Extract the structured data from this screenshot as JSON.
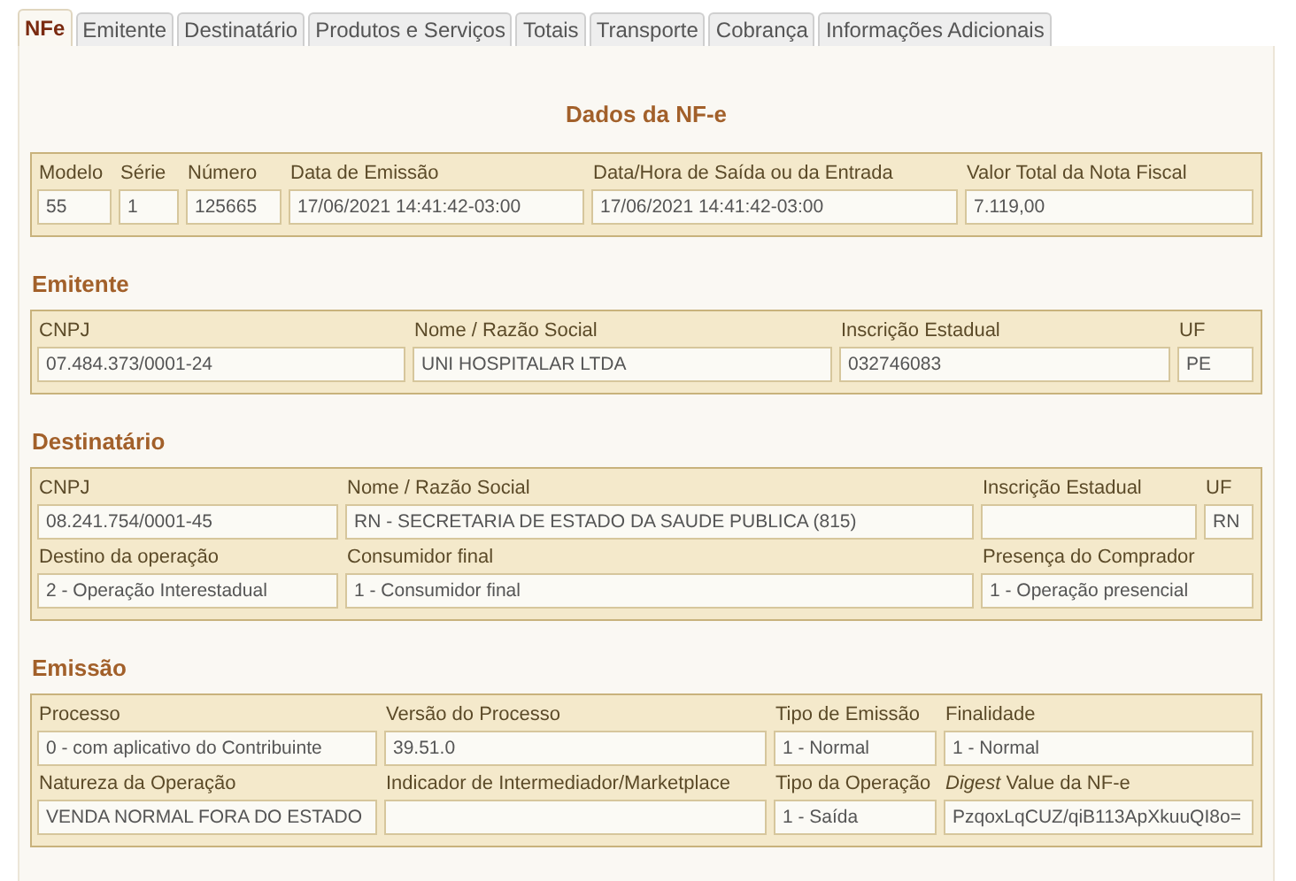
{
  "tabs": [
    {
      "label": "NFe",
      "selected": true
    },
    {
      "label": "Emitente",
      "selected": false
    },
    {
      "label": "Destinatário",
      "selected": false
    },
    {
      "label": "Produtos e Serviços",
      "selected": false
    },
    {
      "label": "Totais",
      "selected": false
    },
    {
      "label": "Transporte",
      "selected": false
    },
    {
      "label": "Cobrança",
      "selected": false
    },
    {
      "label": "Informações Adicionais",
      "selected": false
    }
  ],
  "sections": [
    {
      "title": "Dados da NF-e",
      "kind": "centered",
      "rows": [
        [
          {
            "label": "Modelo",
            "value": "55"
          },
          {
            "label": "Série",
            "value": "1"
          },
          {
            "label": "Número",
            "value": "125665"
          },
          {
            "label": "Data de Emissão",
            "value": "17/06/2021 14:41:42-03:00"
          },
          {
            "label": "Data/Hora de Saída ou da Entrada",
            "value": "17/06/2021 14:41:42-03:00"
          },
          {
            "label": "Valor Total da Nota Fiscal",
            "value": "7.119,00"
          }
        ]
      ]
    },
    {
      "title": "Emitente",
      "kind": "plain",
      "rows": [
        [
          {
            "label": "CNPJ",
            "value": "07.484.373/0001-24"
          },
          {
            "label": "Nome / Razão Social",
            "value": "UNI HOSPITALAR LTDA"
          },
          {
            "label": "Inscrição Estadual",
            "value": "032746083"
          },
          {
            "label": "UF",
            "value": "PE"
          }
        ]
      ]
    },
    {
      "title": "Destinatário",
      "kind": "plain",
      "rows": [
        [
          {
            "label": "CNPJ",
            "value": "08.241.754/0001-45"
          },
          {
            "label": "Nome / Razão Social",
            "value": "RN - SECRETARIA DE ESTADO DA SAUDE PUBLICA (815)"
          },
          {
            "label": "Inscrição Estadual"
          },
          {
            "label": "UF",
            "value": "RN"
          }
        ],
        [
          {
            "label": "Destino da operação",
            "value": "2 - Operação Interestadual"
          },
          {
            "label": "Consumidor final",
            "value": "1 - Consumidor final"
          },
          {
            "label": "Presença do Comprador",
            "value": "1 - Operação presencial"
          }
        ]
      ]
    },
    {
      "title": "Emissão",
      "kind": "plain",
      "rows": [
        [
          {
            "label": "Processo",
            "value": "0 - com aplicativo do Contribuinte"
          },
          {
            "label": "Versão do Processo",
            "value": "39.51.0"
          },
          {
            "label": "Tipo de Emissão",
            "value": "1 - Normal"
          },
          {
            "label": "Finalidade",
            "value": "1 - Normal"
          }
        ],
        [
          {
            "label": "Natureza da Operação",
            "value": "VENDA NORMAL FORA DO ESTADO"
          },
          {
            "label": "Indicador de Intermediador/Marketplace"
          },
          {
            "label": "Tipo da Operação",
            "value": "1 - Saída"
          },
          {
            "label": "*Digest* Value da NF-e",
            "value": "PzqoxLqCUZ/qiB113ApXkuuQI8o="
          }
        ]
      ]
    }
  ]
}
